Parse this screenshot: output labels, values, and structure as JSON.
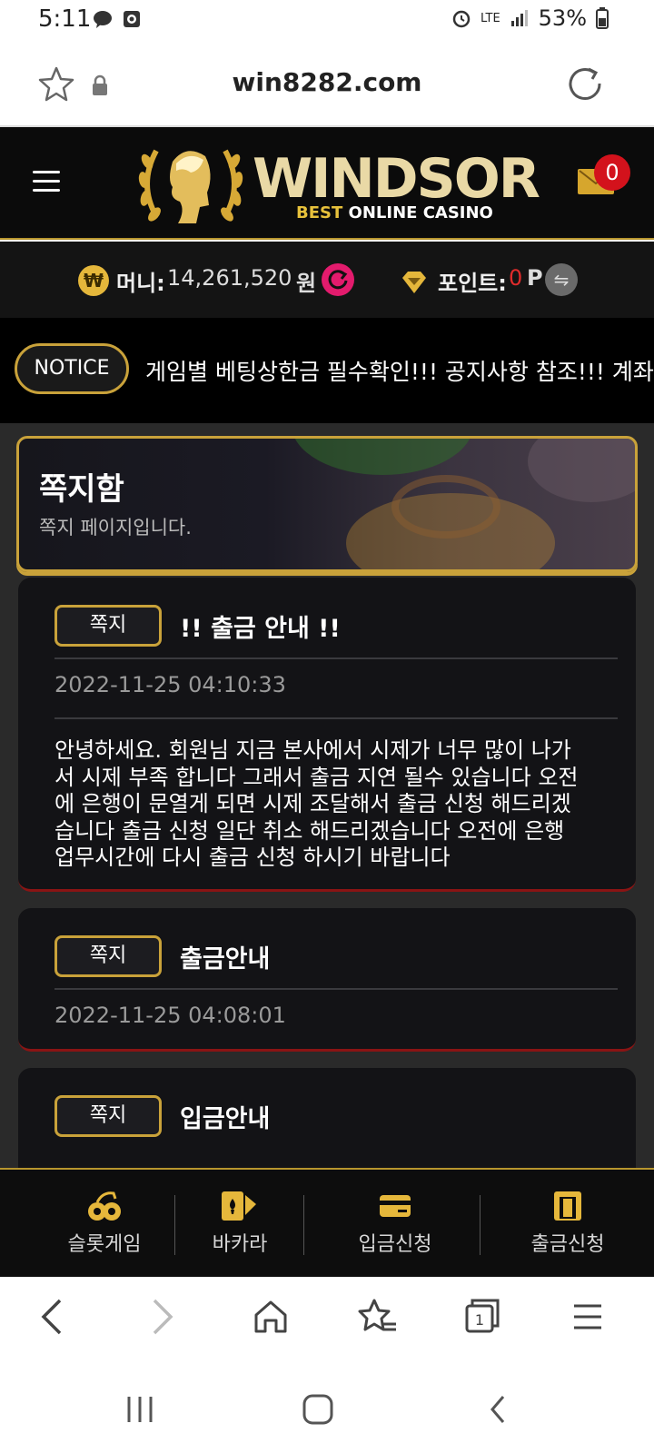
{
  "status_bar": {
    "time": "5:11",
    "network": "LTE",
    "battery": "53%"
  },
  "browser": {
    "url": "win8282.com",
    "tab_count": "1"
  },
  "header": {
    "logo_text": "WINDSOR",
    "logo_sub_best": "BEST",
    "logo_sub_rest": " ONLINE CASINO",
    "mail_count": "0"
  },
  "account": {
    "won_symbol": "₩",
    "money_label": "머니:",
    "money_value": "14,261,520",
    "money_unit": "원",
    "point_label": "포인트:",
    "point_value": "0",
    "point_unit": "P"
  },
  "notice": {
    "badge": "NOTICE",
    "text": "게임별 베팅상한금 필수확인!!! 공지사항 참조!!! 계좌"
  },
  "page_header": {
    "title": "쪽지함",
    "subtitle": "쪽지 페이지입니다."
  },
  "messages": [
    {
      "tag": "쪽지",
      "title": "!! 출금 안내 !!",
      "date": "2022-11-25 04:10:33",
      "body_lines": [
        "안녕하세요. 회원님 지금 본사에서 시제가 너무 많이 나가",
        "서 시제 부족 합니다 그래서 출금 지연 될수 있습니다 오전",
        "에 은행이 문열게 되면 시제 조달해서 출금 신청 해드리겠",
        "습니다 출금 신청 일단 취소 해드리겠습니다 오전에 은행",
        "업무시간에 다시 출금 신청 하시기 바랍니다"
      ]
    },
    {
      "tag": "쪽지",
      "title": "출금안내",
      "date": "2022-11-25 04:08:01"
    },
    {
      "tag": "쪽지",
      "title": "입금안내"
    }
  ],
  "bottom_nav": [
    {
      "label": "슬롯게임",
      "icon": "slot-icon"
    },
    {
      "label": "바카라",
      "icon": "baccarat-card-icon"
    },
    {
      "label": "입금신청",
      "icon": "deposit-card-icon"
    },
    {
      "label": "출금신청",
      "icon": "withdraw-icon"
    }
  ],
  "colors": {
    "gold": "#c9a23a",
    "badge_red": "#d3121c",
    "refresh_pink": "#e31b6d",
    "point_red": "#e02b2b"
  }
}
